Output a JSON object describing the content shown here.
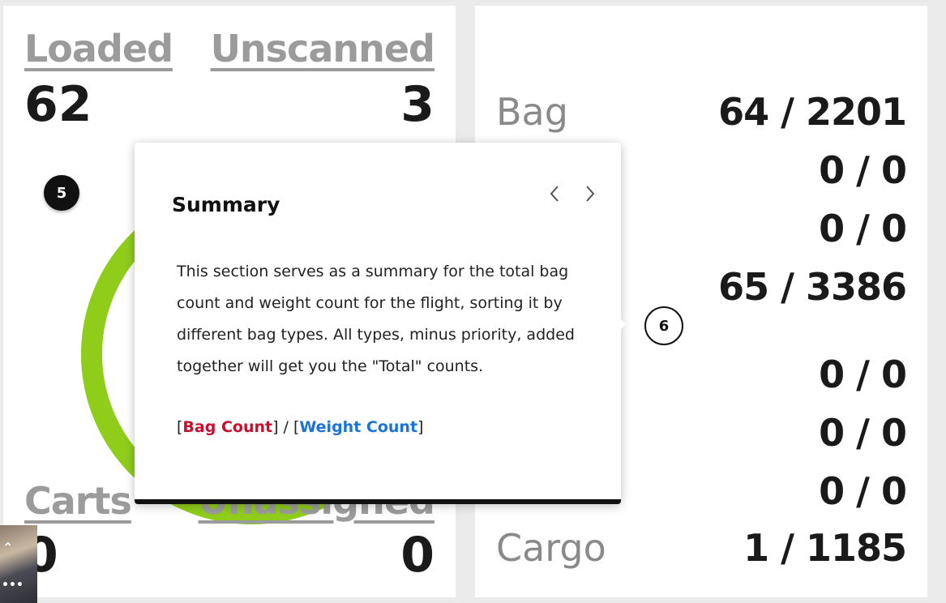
{
  "left_panel": {
    "loaded": {
      "label": "Loaded",
      "value": "62"
    },
    "unscanned": {
      "label": "Unscanned",
      "value": "3"
    },
    "carts": {
      "label": "Carts",
      "value": "0"
    },
    "unassigned": {
      "label": "Unassigned",
      "value": "0"
    }
  },
  "right_panel": {
    "rows": [
      {
        "label": "Bag",
        "value": "64 / 2201"
      },
      {
        "label": "",
        "value": "0 / 0"
      },
      {
        "label": "",
        "value": "0 / 0"
      },
      {
        "label": "",
        "value": "65 / 3386"
      },
      {
        "label": "",
        "value": "0 / 0"
      },
      {
        "label": "",
        "value": "0 / 0"
      },
      {
        "label": "",
        "value": "0 / 0"
      },
      {
        "label": "Cargo",
        "value": "1 / 1185"
      }
    ]
  },
  "steps": {
    "left": "5",
    "right": "6"
  },
  "tooltip": {
    "title": "Summary",
    "body": "This section serves as a summary for the total bag count and weight count for the flight, sorting it by different bag types. All types, minus priority, added together will get you the \"Total\" counts.",
    "legend": {
      "open1": "[",
      "bag_count": "Bag Count",
      "sep": "] / [",
      "weight_count": "Weight Count",
      "close": "]"
    }
  },
  "colors": {
    "ring": "#8fcd1a",
    "bag_count": "#c8102e",
    "weight_count": "#1a73d9"
  },
  "icons": {
    "prev": "chevron-left-icon",
    "next": "chevron-right-icon"
  }
}
